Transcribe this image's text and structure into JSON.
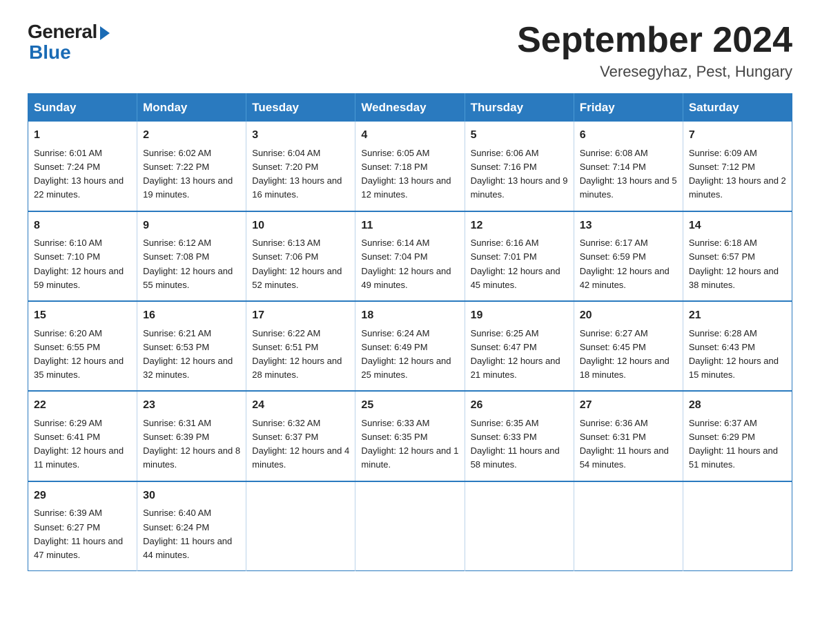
{
  "header": {
    "logo_general": "General",
    "logo_blue": "Blue",
    "month_title": "September 2024",
    "location": "Veresegyhaz, Pest, Hungary"
  },
  "weekdays": [
    "Sunday",
    "Monday",
    "Tuesday",
    "Wednesday",
    "Thursday",
    "Friday",
    "Saturday"
  ],
  "weeks": [
    [
      {
        "day": "1",
        "sunrise": "6:01 AM",
        "sunset": "7:24 PM",
        "daylight": "13 hours and 22 minutes."
      },
      {
        "day": "2",
        "sunrise": "6:02 AM",
        "sunset": "7:22 PM",
        "daylight": "13 hours and 19 minutes."
      },
      {
        "day": "3",
        "sunrise": "6:04 AM",
        "sunset": "7:20 PM",
        "daylight": "13 hours and 16 minutes."
      },
      {
        "day": "4",
        "sunrise": "6:05 AM",
        "sunset": "7:18 PM",
        "daylight": "13 hours and 12 minutes."
      },
      {
        "day": "5",
        "sunrise": "6:06 AM",
        "sunset": "7:16 PM",
        "daylight": "13 hours and 9 minutes."
      },
      {
        "day": "6",
        "sunrise": "6:08 AM",
        "sunset": "7:14 PM",
        "daylight": "13 hours and 5 minutes."
      },
      {
        "day": "7",
        "sunrise": "6:09 AM",
        "sunset": "7:12 PM",
        "daylight": "13 hours and 2 minutes."
      }
    ],
    [
      {
        "day": "8",
        "sunrise": "6:10 AM",
        "sunset": "7:10 PM",
        "daylight": "12 hours and 59 minutes."
      },
      {
        "day": "9",
        "sunrise": "6:12 AM",
        "sunset": "7:08 PM",
        "daylight": "12 hours and 55 minutes."
      },
      {
        "day": "10",
        "sunrise": "6:13 AM",
        "sunset": "7:06 PM",
        "daylight": "12 hours and 52 minutes."
      },
      {
        "day": "11",
        "sunrise": "6:14 AM",
        "sunset": "7:04 PM",
        "daylight": "12 hours and 49 minutes."
      },
      {
        "day": "12",
        "sunrise": "6:16 AM",
        "sunset": "7:01 PM",
        "daylight": "12 hours and 45 minutes."
      },
      {
        "day": "13",
        "sunrise": "6:17 AM",
        "sunset": "6:59 PM",
        "daylight": "12 hours and 42 minutes."
      },
      {
        "day": "14",
        "sunrise": "6:18 AM",
        "sunset": "6:57 PM",
        "daylight": "12 hours and 38 minutes."
      }
    ],
    [
      {
        "day": "15",
        "sunrise": "6:20 AM",
        "sunset": "6:55 PM",
        "daylight": "12 hours and 35 minutes."
      },
      {
        "day": "16",
        "sunrise": "6:21 AM",
        "sunset": "6:53 PM",
        "daylight": "12 hours and 32 minutes."
      },
      {
        "day": "17",
        "sunrise": "6:22 AM",
        "sunset": "6:51 PM",
        "daylight": "12 hours and 28 minutes."
      },
      {
        "day": "18",
        "sunrise": "6:24 AM",
        "sunset": "6:49 PM",
        "daylight": "12 hours and 25 minutes."
      },
      {
        "day": "19",
        "sunrise": "6:25 AM",
        "sunset": "6:47 PM",
        "daylight": "12 hours and 21 minutes."
      },
      {
        "day": "20",
        "sunrise": "6:27 AM",
        "sunset": "6:45 PM",
        "daylight": "12 hours and 18 minutes."
      },
      {
        "day": "21",
        "sunrise": "6:28 AM",
        "sunset": "6:43 PM",
        "daylight": "12 hours and 15 minutes."
      }
    ],
    [
      {
        "day": "22",
        "sunrise": "6:29 AM",
        "sunset": "6:41 PM",
        "daylight": "12 hours and 11 minutes."
      },
      {
        "day": "23",
        "sunrise": "6:31 AM",
        "sunset": "6:39 PM",
        "daylight": "12 hours and 8 minutes."
      },
      {
        "day": "24",
        "sunrise": "6:32 AM",
        "sunset": "6:37 PM",
        "daylight": "12 hours and 4 minutes."
      },
      {
        "day": "25",
        "sunrise": "6:33 AM",
        "sunset": "6:35 PM",
        "daylight": "12 hours and 1 minute."
      },
      {
        "day": "26",
        "sunrise": "6:35 AM",
        "sunset": "6:33 PM",
        "daylight": "11 hours and 58 minutes."
      },
      {
        "day": "27",
        "sunrise": "6:36 AM",
        "sunset": "6:31 PM",
        "daylight": "11 hours and 54 minutes."
      },
      {
        "day": "28",
        "sunrise": "6:37 AM",
        "sunset": "6:29 PM",
        "daylight": "11 hours and 51 minutes."
      }
    ],
    [
      {
        "day": "29",
        "sunrise": "6:39 AM",
        "sunset": "6:27 PM",
        "daylight": "11 hours and 47 minutes."
      },
      {
        "day": "30",
        "sunrise": "6:40 AM",
        "sunset": "6:24 PM",
        "daylight": "11 hours and 44 minutes."
      },
      null,
      null,
      null,
      null,
      null
    ]
  ]
}
